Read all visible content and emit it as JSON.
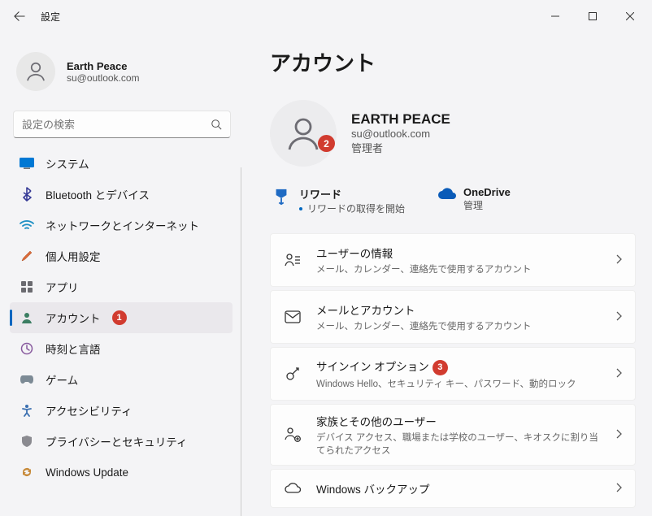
{
  "window": {
    "title": "設定"
  },
  "sidebar": {
    "profile": {
      "name": "Earth Peace",
      "email": "su@outlook.com"
    },
    "search": {
      "placeholder": "設定の検索"
    },
    "items": [
      {
        "label": "システム"
      },
      {
        "label": "Bluetooth とデバイス"
      },
      {
        "label": "ネットワークとインターネット"
      },
      {
        "label": "個人用設定"
      },
      {
        "label": "アプリ"
      },
      {
        "label": "アカウント",
        "badge": "1"
      },
      {
        "label": "時刻と言語"
      },
      {
        "label": "ゲーム"
      },
      {
        "label": "アクセシビリティ"
      },
      {
        "label": "プライバシーとセキュリティ"
      },
      {
        "label": "Windows Update"
      }
    ]
  },
  "main": {
    "heading": "アカウント",
    "account": {
      "name": "EARTH PEACE",
      "email": "su@outlook.com",
      "role": "管理者",
      "badge": "2"
    },
    "cards": {
      "rewards": {
        "title": "リワード",
        "sub": "リワードの取得を開始"
      },
      "onedrive": {
        "title": "OneDrive",
        "sub": "管理"
      }
    },
    "rows": [
      {
        "title": "ユーザーの情報",
        "sub": "メール、カレンダー、連絡先で使用するアカウント"
      },
      {
        "title": "メールとアカウント",
        "sub": "メール、カレンダー、連絡先で使用するアカウント"
      },
      {
        "title": "サインイン オプション",
        "sub": "Windows Hello、セキュリティ キー、パスワード、動的ロック",
        "badge": "3"
      },
      {
        "title": "家族とその他のユーザー",
        "sub": "デバイス アクセス、職場または学校のユーザー、キオスクに割り当てられたアクセス"
      },
      {
        "title": "Windows バックアップ",
        "sub": ""
      }
    ]
  }
}
